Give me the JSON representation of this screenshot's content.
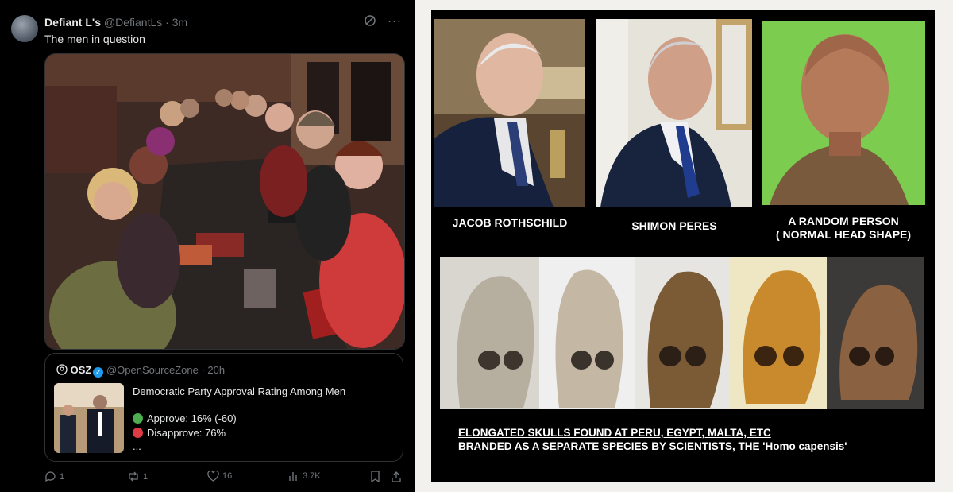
{
  "tweet": {
    "display_name": "Defiant L's",
    "handle": "@DefiantLs",
    "time": "3m",
    "text": "The men in question",
    "quote": {
      "display_name": "OSZ",
      "handle": "@OpenSourceZone",
      "time": "20h",
      "title": "Democratic Party Approval Rating Among Men",
      "approve": "Approve: 16% (-60)",
      "disapprove": "Disapprove: 76%",
      "ellipsis": "...",
      "approve_color": "#4cae4f",
      "disapprove_color": "#dd3b45"
    },
    "actions": {
      "replies": "1",
      "reposts": "1",
      "likes": "16",
      "views": "3.7K"
    }
  },
  "meme": {
    "label_1": "JACOB ROTHSCHILD",
    "label_2": "SHIMON PERES",
    "label_3_line1": "A RANDOM PERSON",
    "label_3_line2": "( NORMAL HEAD SHAPE)",
    "caption_line1": "ELONGATED SKULLS FOUND AT PERU, EGYPT, MALTA, ETC",
    "caption_line2": "BRANDED AS A SEPARATE SPECIES BY SCIENTISTS, THE 'Homo capensis'"
  }
}
